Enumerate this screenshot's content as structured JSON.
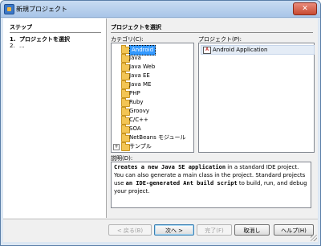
{
  "window": {
    "title": "新規プロジェクト",
    "close_label": "✕"
  },
  "steps": {
    "header": "ステップ",
    "items": [
      {
        "num": "1.",
        "label": "プロジェクトを選択"
      },
      {
        "num": "2.",
        "label": "..."
      }
    ]
  },
  "main": {
    "header": "プロジェクトを選択",
    "categories_label": "カテゴリ(C):",
    "projects_label": "プロジェクト(P):",
    "categories": [
      "Android",
      "Java",
      "Java Web",
      "Java EE",
      "Java ME",
      "PHP",
      "Ruby",
      "Groovy",
      "C/C++",
      "SOA",
      "NetBeans モジュール",
      "サンプル"
    ],
    "selected_category": "Android",
    "projects": [
      {
        "label": "Android Application",
        "icon": "android-app-icon"
      }
    ],
    "description_label": "説明(D):",
    "description": {
      "p1": "Creates a new Java SE application",
      "t1": " in a standard IDE project. You can also generate a main class in the project. Standard projects use ",
      "p2": "an IDE-generated Ant build script",
      "t2": " to build, run, and debug your project."
    }
  },
  "buttons": {
    "back": "< 戻る(B)",
    "next": "次へ >",
    "finish": "完了(F)",
    "cancel": "取消し",
    "help": "ヘルプ(H)"
  }
}
